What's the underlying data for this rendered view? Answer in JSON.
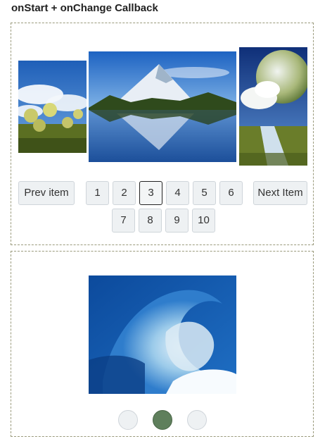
{
  "header": {
    "title": "onStart + onChange Callback"
  },
  "carousel1": {
    "images": [
      {
        "name": "dandelion-field-image"
      },
      {
        "name": "mountain-lake-image"
      },
      {
        "name": "fantasy-planet-image"
      }
    ],
    "prev_label": "Prev item",
    "next_label": "Next Item",
    "pages": [
      "1",
      "2",
      "3",
      "4",
      "5",
      "6",
      "7",
      "8",
      "9",
      "10"
    ],
    "active_page": "3"
  },
  "carousel2": {
    "image": {
      "name": "ocean-wave-image"
    },
    "dots": 3,
    "active_dot": 2
  },
  "colors": {
    "button_bg": "#eef1f3",
    "button_border": "#cfd5da",
    "active_dot": "#5f7f5c",
    "panel_border": "#9a9a7c"
  }
}
